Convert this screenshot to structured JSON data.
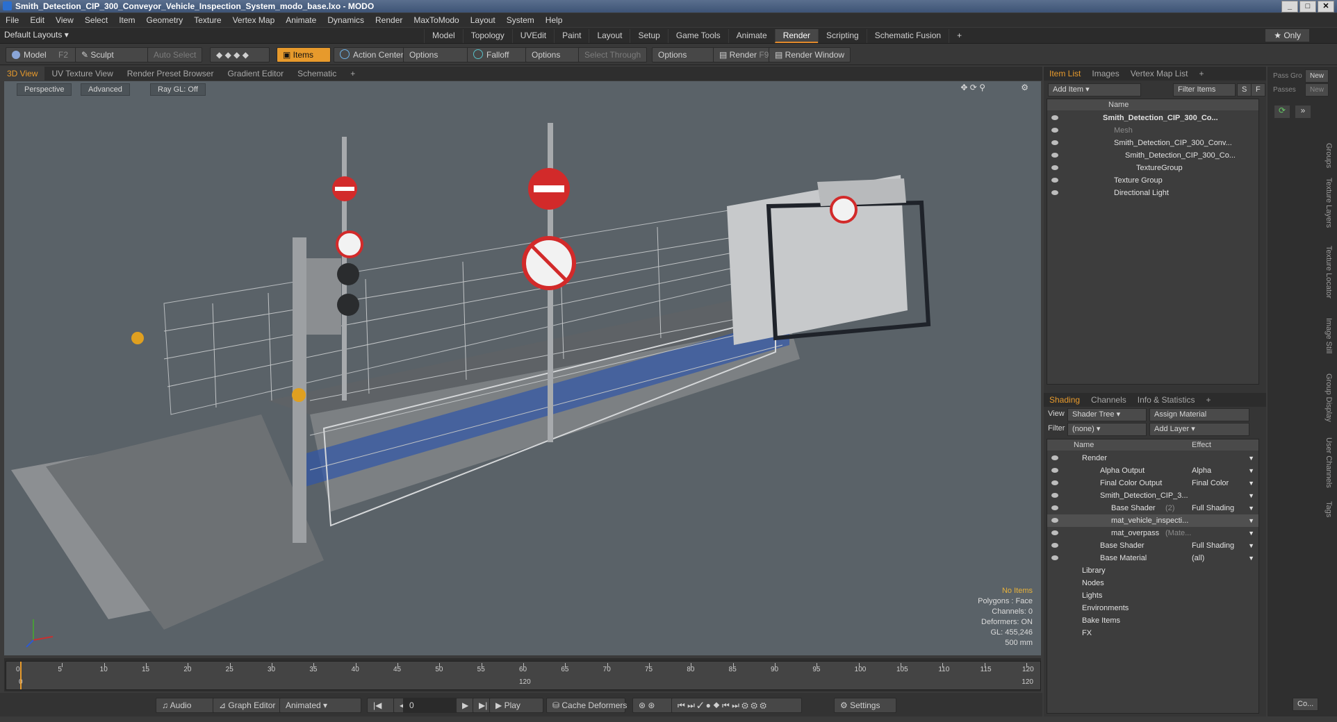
{
  "window": {
    "title": "Smith_Detection_CIP_300_Conveyor_Vehicle_Inspection_System_modo_base.lxo - MODO"
  },
  "menu": [
    "File",
    "Edit",
    "View",
    "Select",
    "Item",
    "Geometry",
    "Texture",
    "Vertex Map",
    "Animate",
    "Dynamics",
    "Render",
    "MaxToModo",
    "Layout",
    "System",
    "Help"
  ],
  "layouts": {
    "label": "Default Layouts ▾"
  },
  "workspace_tabs": [
    "Model",
    "Topology",
    "UVEdit",
    "Paint",
    "Layout",
    "Setup",
    "Game Tools",
    "Animate",
    "Render",
    "Scripting",
    "Schematic Fusion",
    "+"
  ],
  "workspace_active": "Render",
  "only_label": "★ Only",
  "toolbar": {
    "model": "Model",
    "model_key": "F2",
    "sculpt": "Sculpt",
    "auto_select": "Auto Select",
    "items": "Items",
    "action_center": "Action Center",
    "options1": "Options",
    "falloff": "Falloff",
    "options2": "Options",
    "select_through": "Select Through",
    "options3": "Options",
    "render": "Render",
    "render_key": "F9",
    "render_window": "Render Window"
  },
  "viewport_tabs": [
    "3D View",
    "UV Texture View",
    "Render Preset Browser",
    "Gradient Editor",
    "Schematic",
    "+"
  ],
  "viewport_options": {
    "view": "Perspective",
    "shading": "Advanced",
    "raygl": "Ray GL: Off"
  },
  "viewport_info": {
    "no_items": "No Items",
    "polygons": "Polygons : Face",
    "channels": "Channels: 0",
    "deformers": "Deformers: ON",
    "gl": "GL: 455,246",
    "size": "500 mm"
  },
  "timeline": {
    "ticks": [
      "0",
      "5",
      "10",
      "15",
      "20",
      "25",
      "30",
      "35",
      "40",
      "45",
      "50",
      "55",
      "60",
      "65",
      "70",
      "75",
      "80",
      "85",
      "90",
      "95",
      "100",
      "105",
      "110",
      "115",
      "120"
    ],
    "start": "0",
    "mid": "120",
    "end": "120"
  },
  "transport": {
    "audio": "Audio",
    "graph_editor": "Graph Editor",
    "animated": "Animated",
    "frame": "0",
    "play": "Play",
    "cache_deformers": "Cache Deformers",
    "settings": "Settings"
  },
  "item_list": {
    "tabs": [
      "Item List",
      "Images",
      "Vertex Map List",
      "+"
    ],
    "add_item": "Add Item",
    "filter_items": "Filter Items",
    "s": "S",
    "f": "F",
    "col_name": "Name",
    "rows": [
      "Smith_Detection_CIP_300_Co...",
      "Mesh",
      "Smith_Detection_CIP_300_Conv...",
      "Smith_Detection_CIP_300_Co...",
      "TextureGroup",
      "Texture Group",
      "Directional Light"
    ]
  },
  "shading": {
    "tabs": [
      "Shading",
      "Channels",
      "Info & Statistics",
      "+"
    ],
    "view_label": "View",
    "view_value": "Shader Tree",
    "assign_material": "Assign Material",
    "filter_label": "Filter",
    "filter_value": "(none)",
    "add_layer": "Add Layer",
    "col_name": "Name",
    "col_effect": "Effect",
    "rows": [
      {
        "name": "Render",
        "effect": ""
      },
      {
        "name": "Alpha Output",
        "effect": "Alpha"
      },
      {
        "name": "Final Color Output",
        "effect": "Final Color"
      },
      {
        "name": "Smith_Detection_CIP_3...",
        "effect": ""
      },
      {
        "name": "Base Shader",
        "extra": "(2)",
        "effect": "Full Shading"
      },
      {
        "name": "mat_vehicle_inspecti...",
        "effect": ""
      },
      {
        "name": "mat_overpass",
        "extra": "(Mate...",
        "effect": ""
      },
      {
        "name": "Base Shader",
        "effect": "Full Shading"
      },
      {
        "name": "Base Material",
        "effect": "(all)"
      },
      {
        "name": "Library",
        "effect": ""
      },
      {
        "name": "Nodes",
        "effect": ""
      },
      {
        "name": "Lights",
        "effect": ""
      },
      {
        "name": "Environments",
        "effect": ""
      },
      {
        "name": "Bake Items",
        "effect": ""
      },
      {
        "name": "FX",
        "effect": ""
      }
    ]
  },
  "right_strip": {
    "pass_gro": "Pass Gro",
    "new1": "New",
    "passes": "Passes",
    "new2": "New",
    "vertical_tabs": [
      "Groups",
      "Texture Layers",
      "Texture Locator",
      "Image Still",
      "Group Display",
      "User Channels",
      "Tags"
    ],
    "bottom_btn": "Co..."
  },
  "colors": {
    "accent": "#e79a2c",
    "viewport_bg": "#5a6268"
  }
}
